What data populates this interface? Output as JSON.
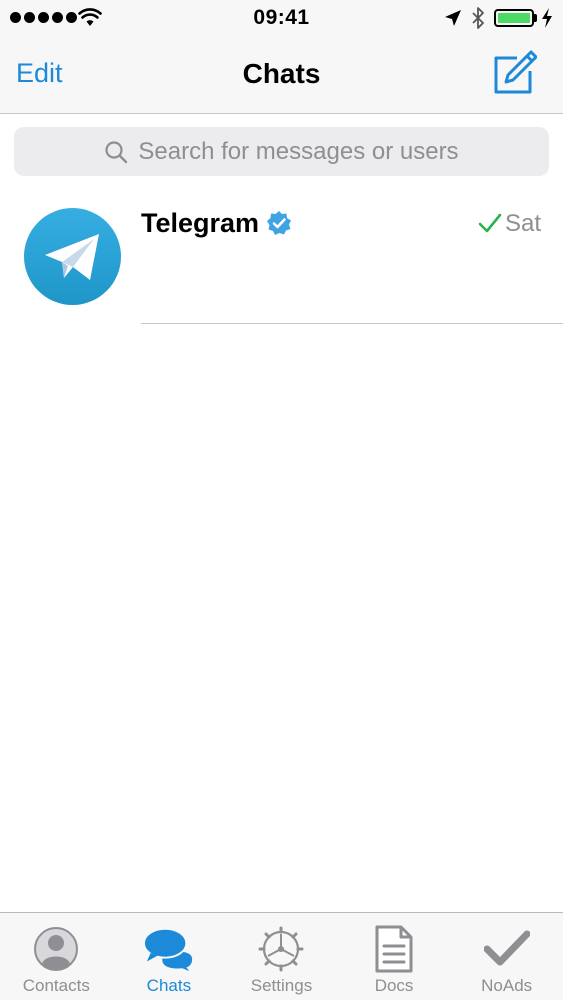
{
  "status_bar": {
    "time": "09:41",
    "signal_icon": "signal-dots-icon",
    "wifi_icon": "wifi-icon",
    "location_icon": "location-arrow-icon",
    "bluetooth_icon": "bluetooth-icon",
    "battery_icon": "battery-icon",
    "battery_level": 1.0,
    "charging_icon": "bolt-icon"
  },
  "nav": {
    "edit_label": "Edit",
    "title": "Chats",
    "compose_icon": "compose-icon"
  },
  "search": {
    "placeholder": "Search for messages or users",
    "icon": "search-icon"
  },
  "chats": [
    {
      "name": "Telegram",
      "verified": true,
      "time": "Sat",
      "status_icon": "checkmark-icon",
      "avatar_icon": "paper-plane-icon"
    }
  ],
  "tabs": [
    {
      "label": "Contacts",
      "icon": "person-icon",
      "active": false
    },
    {
      "label": "Chats",
      "icon": "chat-bubbles-icon",
      "active": true
    },
    {
      "label": "Settings",
      "icon": "gear-icon",
      "active": false
    },
    {
      "label": "Docs",
      "icon": "document-icon",
      "active": false
    },
    {
      "label": "NoAds",
      "icon": "checkmark-icon",
      "active": false
    }
  ],
  "colors": {
    "accent": "#1c8ad8",
    "battery": "#4cd964",
    "read_check": "#2bb34a",
    "avatar": "#2ea6dd",
    "verified": "#3fa4e3",
    "inactive": "#8e8e93"
  }
}
